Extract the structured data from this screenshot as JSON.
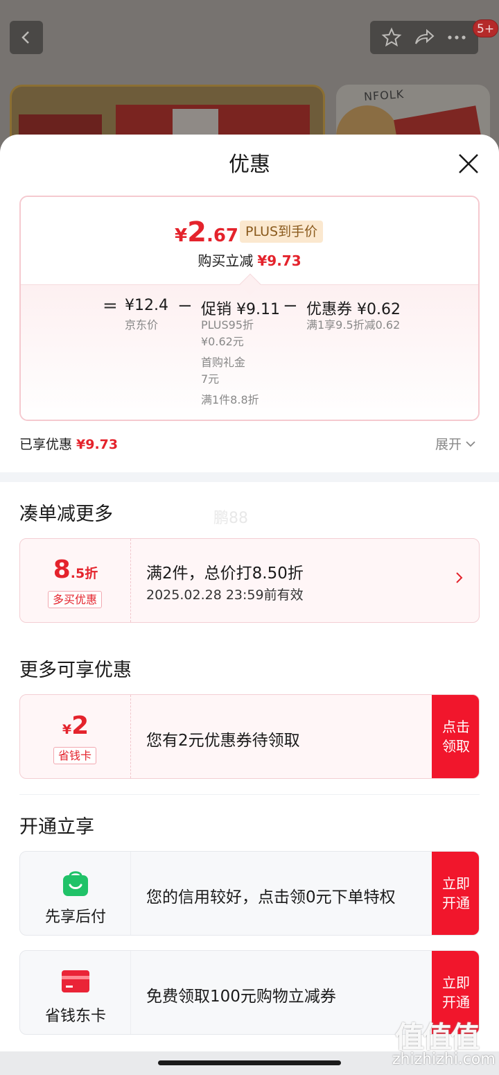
{
  "background": {
    "badge": "5+",
    "brand_text": "NFOLK"
  },
  "sheet": {
    "title": "优惠"
  },
  "price_summary": {
    "currency": "¥",
    "final_int": "2",
    "final_dec": ".67",
    "plus_tag": "PLUS到手价",
    "buy_reduce_label": "购买立减",
    "buy_reduce_amount": "¥9.73",
    "formula": {
      "equals": "=",
      "minus": "−",
      "jd_price": "¥12.4",
      "jd_price_label": "京东价",
      "promo": "促销 ¥9.11",
      "promo_items": [
        "PLUS95折",
        "¥0.62元",
        "首购礼金",
        "7元",
        "满1件8.8折"
      ],
      "coupon": "优惠券 ¥0.62",
      "coupon_desc": "满1享9.5折减0.62"
    }
  },
  "enjoyed": {
    "label": "已享优惠",
    "amount": "¥9.73",
    "expand_label": "展开"
  },
  "bundle_section": {
    "title": "凑单减更多",
    "watermark": "鹏88",
    "discount_num": "8",
    "discount_suffix": ".5折",
    "tag": "多买优惠",
    "line1": "满2件，总价打8.50折",
    "line2": "2025.02.28 23:59前有效"
  },
  "more_section": {
    "title": "更多可享优惠",
    "currency": "¥",
    "amount": "2",
    "tag": "省钱卡",
    "text": "您有2元优惠券待领取",
    "cta": "点击领取"
  },
  "open_section": {
    "title": "开通立享",
    "items": [
      {
        "name": "先享后付",
        "text": "您的信用较好，点击领0元下单特权",
        "cta": "立即开通",
        "icon_color": "#20c268"
      },
      {
        "name": "省钱东卡",
        "text": "免费领取100元购物立减券",
        "cta": "立即开通",
        "icon_color": "#ea2437"
      }
    ]
  },
  "footer": {
    "logo_text": "值值值",
    "url": "zhizhizhi.com"
  },
  "colors": {
    "accent_red": "#e4232c",
    "cta_red": "#f1162c"
  }
}
